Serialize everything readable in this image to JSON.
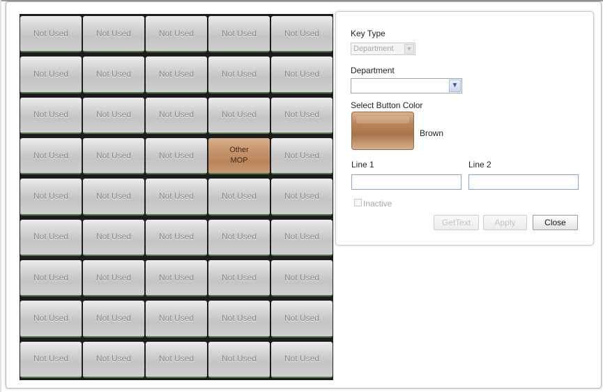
{
  "keyboard": {
    "rows": [
      [
        "Not Used",
        "Not Used",
        "Not Used",
        "Not Used",
        "Not Used"
      ],
      [
        "Not Used",
        "Not Used",
        "Not Used",
        "Not Used",
        "Not Used"
      ],
      [
        "Not Used",
        "Not Used",
        "Not Used",
        "Not Used",
        "Not Used"
      ],
      [
        "Not Used",
        "Not Used",
        "Not Used",
        "Other\nMOP",
        "Not Used"
      ],
      [
        "Not Used",
        "Not Used",
        "Not Used",
        "Not Used",
        "Not Used"
      ],
      [
        "Not Used",
        "Not Used",
        "Not Used",
        "Not Used",
        "Not Used"
      ],
      [
        "Not Used",
        "Not Used",
        "Not Used",
        "Not Used",
        "Not Used"
      ],
      [
        "Not Used",
        "Not Used",
        "Not Used",
        "Not Used",
        "Not Used"
      ],
      [
        "Not Used",
        "Not Used",
        "Not Used",
        "Not Used",
        "Not Used"
      ]
    ],
    "selected_key": {
      "row": 3,
      "col": 3,
      "color": "brown"
    },
    "colors": {
      "default_key": "#cfcfcf",
      "brown_key": "#c4936a",
      "key_bottom_border": "#4f7a44"
    }
  },
  "editor": {
    "key_type_label": "Key Type",
    "key_type_value": "Department",
    "department_label": "Department",
    "department_value": "",
    "color_label": "Select Button Color",
    "color_name": "Brown",
    "line1_label": "Line 1",
    "line2_label": "Line 2",
    "line1_value": "",
    "line2_value": "",
    "inactive_label": "Inactive",
    "gettext_label": "GetText",
    "apply_label": "Apply",
    "close_label": "Close"
  }
}
